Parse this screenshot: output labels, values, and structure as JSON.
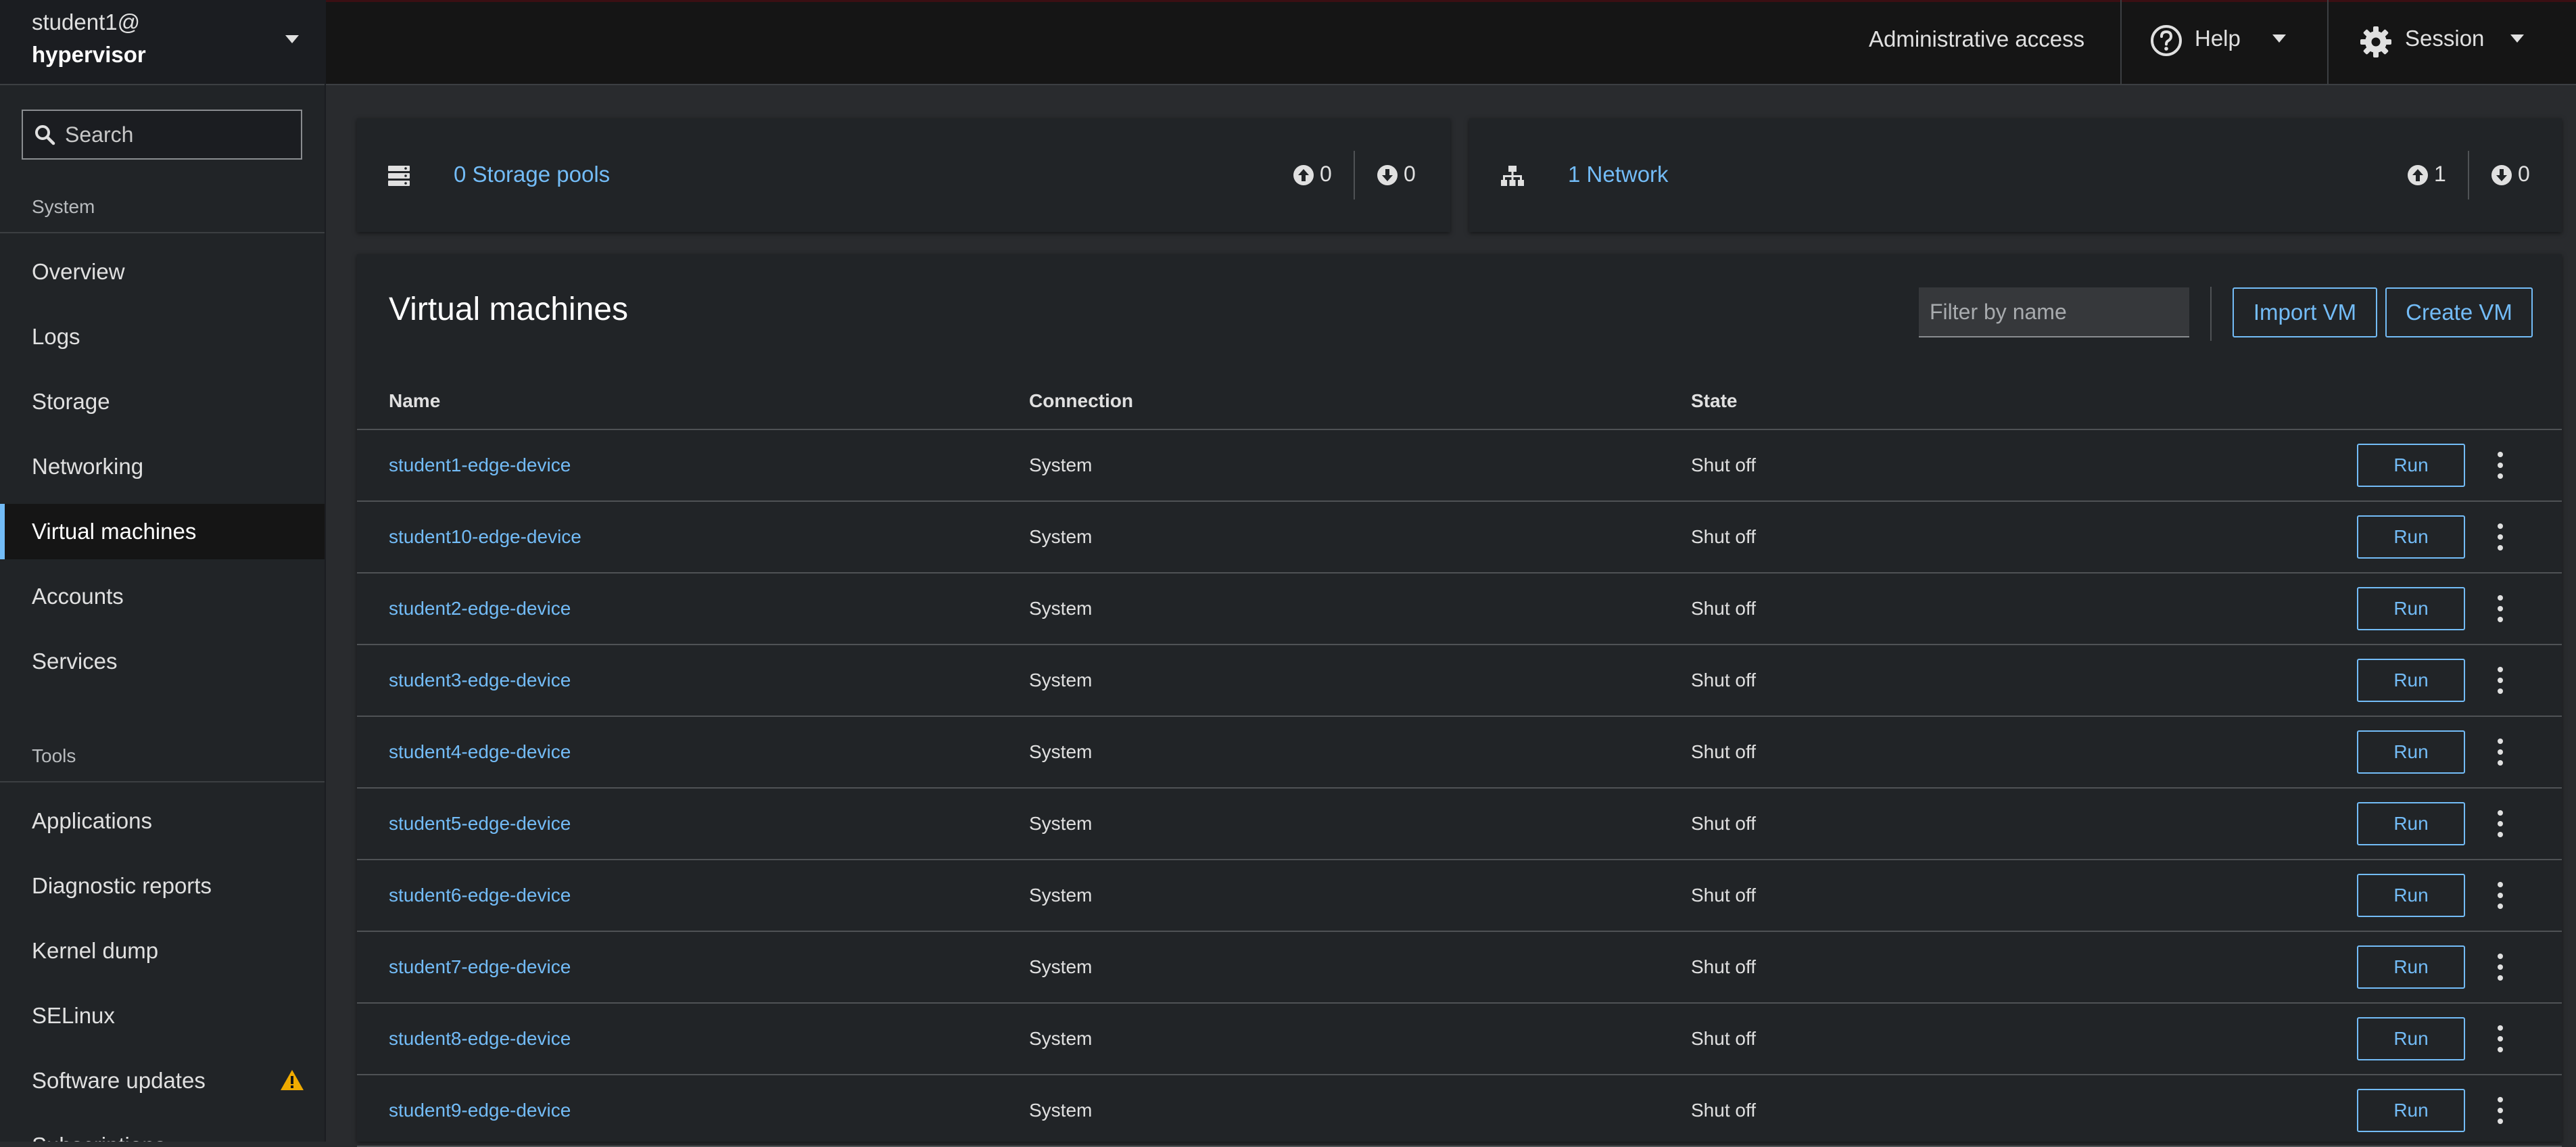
{
  "host": {
    "user": "student1@",
    "name": "hypervisor"
  },
  "search": {
    "placeholder": "Search"
  },
  "nav": {
    "system_title": "System",
    "system_items": [
      {
        "label": "Overview"
      },
      {
        "label": "Logs"
      },
      {
        "label": "Storage"
      },
      {
        "label": "Networking"
      },
      {
        "label": "Virtual machines",
        "active": true
      },
      {
        "label": "Accounts"
      },
      {
        "label": "Services"
      }
    ],
    "tools_title": "Tools",
    "tools_items": [
      {
        "label": "Applications"
      },
      {
        "label": "Diagnostic reports"
      },
      {
        "label": "Kernel dump"
      },
      {
        "label": "SELinux"
      },
      {
        "label": "Software updates",
        "icon": "warning-icon"
      },
      {
        "label": "Subscriptions"
      }
    ]
  },
  "masthead": {
    "admin_access": "Administrative access",
    "help_label": "Help",
    "session_label": "Session"
  },
  "storage_card": {
    "link": "0 Storage pools",
    "active": "0",
    "inactive": "0"
  },
  "network_card": {
    "link": "1 Network",
    "active": "1",
    "inactive": "0"
  },
  "vms": {
    "title": "Virtual machines",
    "filter_placeholder": "Filter by name",
    "import_label": "Import VM",
    "create_label": "Create VM",
    "columns": {
      "name": "Name",
      "connection": "Connection",
      "state": "State"
    },
    "run_label": "Run",
    "rows": [
      {
        "name": "student1-edge-device",
        "connection": "System",
        "state": "Shut off"
      },
      {
        "name": "student10-edge-device",
        "connection": "System",
        "state": "Shut off"
      },
      {
        "name": "student2-edge-device",
        "connection": "System",
        "state": "Shut off"
      },
      {
        "name": "student3-edge-device",
        "connection": "System",
        "state": "Shut off"
      },
      {
        "name": "student4-edge-device",
        "connection": "System",
        "state": "Shut off"
      },
      {
        "name": "student5-edge-device",
        "connection": "System",
        "state": "Shut off"
      },
      {
        "name": "student6-edge-device",
        "connection": "System",
        "state": "Shut off"
      },
      {
        "name": "student7-edge-device",
        "connection": "System",
        "state": "Shut off"
      },
      {
        "name": "student8-edge-device",
        "connection": "System",
        "state": "Shut off"
      },
      {
        "name": "student9-edge-device",
        "connection": "System",
        "state": "Shut off"
      }
    ]
  },
  "colors": {
    "link": "#73bcf7",
    "warning": "#f0ab00",
    "active_indicator": "#73bcf7"
  }
}
